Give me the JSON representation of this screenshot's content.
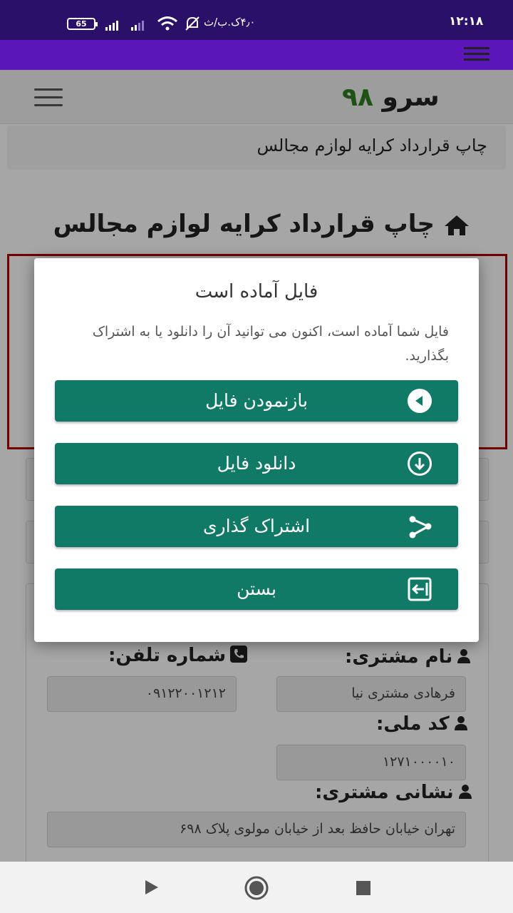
{
  "status_bar": {
    "time": "۱۲:۱۸",
    "carrier_text": "۴٫۰ک.ب/ث",
    "battery": "65"
  },
  "header": {
    "brand_text": "سرو",
    "brand_number": "۹۸"
  },
  "breadcrumb": "چاپ قرارداد کرایه لوازم مجالس",
  "page_title": "چاپ قرارداد کرایه لوازم مجالس",
  "modal": {
    "title": "فایل آماده است",
    "message": "فایل شما آماده است، اکنون می توانید آن را دانلود یا به اشتراک بگذارید.",
    "buttons": [
      {
        "label": "بازنمودن فایل",
        "icon": "play-circle-icon"
      },
      {
        "label": "دانلود فایل",
        "icon": "download-icon"
      },
      {
        "label": "اشتراک گذاری",
        "icon": "share-icon"
      },
      {
        "label": "بستن",
        "icon": "exit-icon"
      }
    ]
  },
  "form": {
    "customer_name_label": "نام مشتری:",
    "customer_name_value": "فرهادی مشتری نیا",
    "phone_label": "شماره تلفن:",
    "phone_value": "۰۹۱۲۲۰۰۱۲۱۲",
    "national_code_label": "کد ملی:",
    "national_code_value": "۱۲۷۱۰۰۰۰۱۰",
    "address_label": "نشانی مشتری:",
    "address_value": "تهران خیابان حافظ بعد از خیابان مولوی پلاک ۶۹۸"
  },
  "colors": {
    "status_bar": "#2a1068",
    "app_bar": "#5a16b8",
    "button": "#117a67",
    "alert_border": "#b00000",
    "brand_number": "#2f7d1f"
  }
}
